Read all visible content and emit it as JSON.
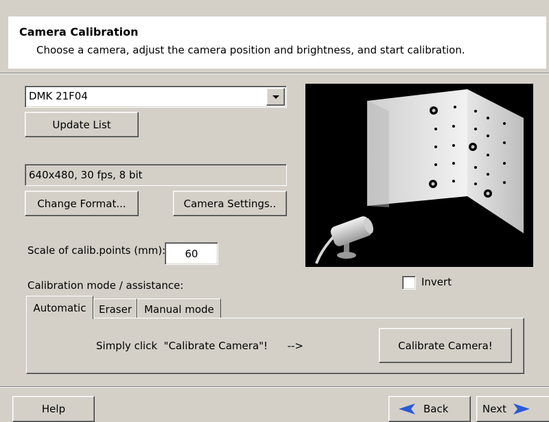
{
  "header": {
    "title": "Camera Calibration",
    "subtitle": "Choose a camera, adjust the camera position and brightness, and start calibration."
  },
  "camera": {
    "selected": "DMK 21F04",
    "update_list_label": "Update List",
    "format": "640x480, 30 fps, 8 bit",
    "change_format_label": "Change Format...",
    "camera_settings_label": "Camera Settings.."
  },
  "scale": {
    "label": "Scale of calib.points (mm):",
    "value": "60"
  },
  "mode": {
    "label": "Calibration mode / assistance:",
    "tabs": [
      "Automatic",
      "Eraser",
      "Manual mode"
    ],
    "instruction": "Simply click  \"Calibrate Camera\"!      -->",
    "calibrate_label": "Calibrate Camera!"
  },
  "preview": {
    "invert_label": "Invert",
    "invert_checked": false
  },
  "footer": {
    "help_label": "Help",
    "back_label": "Back",
    "next_label": "Next"
  }
}
